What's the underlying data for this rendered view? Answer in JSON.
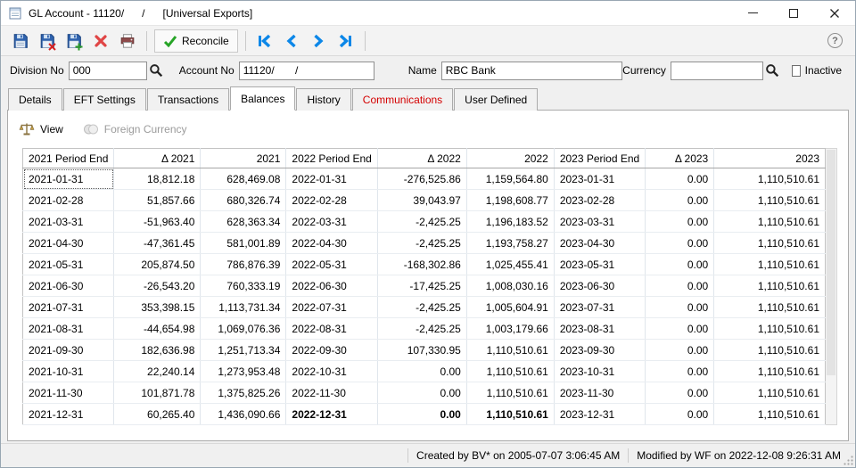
{
  "window": {
    "title": "GL Account - 11120/      /      [Universal Exports]"
  },
  "toolbar": {
    "reconcile_label": "Reconcile",
    "help_label": "?"
  },
  "form": {
    "division_label": "Division No",
    "division_value": "000",
    "account_label": "Account No",
    "account_value": "11120/       /",
    "name_label": "Name",
    "name_value": "RBC Bank",
    "currency_label": "Currency",
    "currency_value": "",
    "inactive_label": "Inactive"
  },
  "tabs": [
    {
      "label": "Details",
      "active": false
    },
    {
      "label": "EFT Settings",
      "active": false
    },
    {
      "label": "Transactions",
      "active": false
    },
    {
      "label": "Balances",
      "active": true
    },
    {
      "label": "History",
      "active": false
    },
    {
      "label": "Communications",
      "active": false,
      "color": "#d40000"
    },
    {
      "label": "User Defined",
      "active": false
    }
  ],
  "view_bar": {
    "view_label": "View",
    "foreign_currency_label": "Foreign Currency"
  },
  "balances": {
    "columns": [
      {
        "label": "2021 Period End",
        "align": "left"
      },
      {
        "label": "Δ 2021",
        "align": "right"
      },
      {
        "label": "2021",
        "align": "right"
      },
      {
        "label": "2022 Period End",
        "align": "left"
      },
      {
        "label": "Δ 2022",
        "align": "right"
      },
      {
        "label": "2022",
        "align": "right"
      },
      {
        "label": "2023 Period End",
        "align": "left"
      },
      {
        "label": "Δ 2023",
        "align": "right"
      },
      {
        "label": "2023",
        "align": "right"
      }
    ],
    "focus_cell": {
      "row": 0,
      "col": 0
    },
    "rows": [
      {
        "cells": [
          "2021-01-31",
          "18,812.18",
          "628,469.08",
          "2022-01-31",
          "-276,525.86",
          "1,159,564.80",
          "2023-01-31",
          "0.00",
          "1,110,510.61"
        ]
      },
      {
        "cells": [
          "2021-02-28",
          "51,857.66",
          "680,326.74",
          "2022-02-28",
          "39,043.97",
          "1,198,608.77",
          "2023-02-28",
          "0.00",
          "1,110,510.61"
        ]
      },
      {
        "cells": [
          "2021-03-31",
          "-51,963.40",
          "628,363.34",
          "2022-03-31",
          "-2,425.25",
          "1,196,183.52",
          "2023-03-31",
          "0.00",
          "1,110,510.61"
        ]
      },
      {
        "cells": [
          "2021-04-30",
          "-47,361.45",
          "581,001.89",
          "2022-04-30",
          "-2,425.25",
          "1,193,758.27",
          "2023-04-30",
          "0.00",
          "1,110,510.61"
        ]
      },
      {
        "cells": [
          "2021-05-31",
          "205,874.50",
          "786,876.39",
          "2022-05-31",
          "-168,302.86",
          "1,025,455.41",
          "2023-05-31",
          "0.00",
          "1,110,510.61"
        ]
      },
      {
        "cells": [
          "2021-06-30",
          "-26,543.20",
          "760,333.19",
          "2022-06-30",
          "-17,425.25",
          "1,008,030.16",
          "2023-06-30",
          "0.00",
          "1,110,510.61"
        ]
      },
      {
        "cells": [
          "2021-07-31",
          "353,398.15",
          "1,113,731.34",
          "2022-07-31",
          "-2,425.25",
          "1,005,604.91",
          "2023-07-31",
          "0.00",
          "1,110,510.61"
        ]
      },
      {
        "cells": [
          "2021-08-31",
          "-44,654.98",
          "1,069,076.36",
          "2022-08-31",
          "-2,425.25",
          "1,003,179.66",
          "2023-08-31",
          "0.00",
          "1,110,510.61"
        ]
      },
      {
        "cells": [
          "2021-09-30",
          "182,636.98",
          "1,251,713.34",
          "2022-09-30",
          "107,330.95",
          "1,110,510.61",
          "2023-09-30",
          "0.00",
          "1,110,510.61"
        ]
      },
      {
        "cells": [
          "2021-10-31",
          "22,240.14",
          "1,273,953.48",
          "2022-10-31",
          "0.00",
          "1,110,510.61",
          "2023-10-31",
          "0.00",
          "1,110,510.61"
        ]
      },
      {
        "cells": [
          "2021-11-30",
          "101,871.78",
          "1,375,825.26",
          "2022-11-30",
          "0.00",
          "1,110,510.61",
          "2023-11-30",
          "0.00",
          "1,110,510.61"
        ]
      },
      {
        "cells": [
          "2021-12-31",
          "60,265.40",
          "1,436,090.66",
          "2022-12-31",
          "0.00",
          "1,110,510.61",
          "2023-12-31",
          "0.00",
          "1,110,510.61"
        ],
        "bold": [
          3,
          4,
          5
        ]
      }
    ]
  },
  "statusbar": {
    "created": "Created by BV* on 2005-07-07 3:06:45 AM",
    "modified": "Modified by WF on 2022-12-08 9:26:31 AM"
  }
}
